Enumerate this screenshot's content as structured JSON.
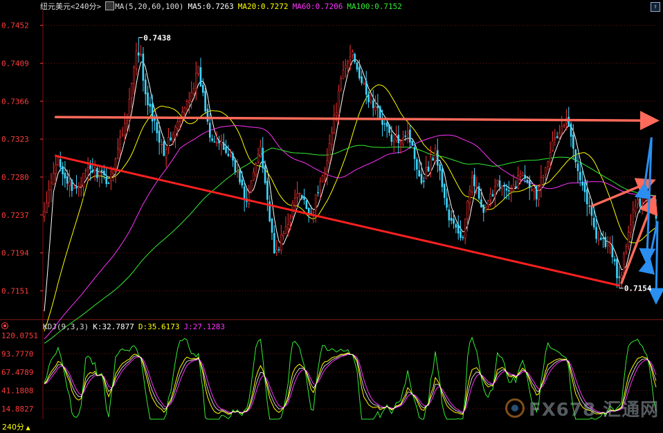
{
  "header": {
    "symbol": "纽元美元",
    "period": "<240分>",
    "ma_params": "MA(5,20,60,100)",
    "ma5": "MA5:0.7263",
    "ma20": "MA20:0.7272",
    "ma60": "MA60:0.7206",
    "ma100": "MA100:0.7152"
  },
  "kdj_header": {
    "params": "KDJ(9,3,3)",
    "k": "K:32.7877",
    "d": "D:35.6173",
    "j": "J:27.1283"
  },
  "period_tab": "240分",
  "watermark": "FX678 汇通网",
  "colors": {
    "up": "#ff3333",
    "down": "#3fd7ff",
    "ma5": "#ffffff",
    "ma20": "#ffff00",
    "ma60": "#ff33ff",
    "ma100": "#33ee33",
    "trend_red": "#ff2020",
    "trend_salmon": "#ff6a5a",
    "arrow_blue": "#2a8ff0",
    "grid": "#7a1010",
    "axis_text": "#ff3b3b"
  },
  "chart_data": [
    {
      "type": "candlestick",
      "title": "纽元美元<240分>",
      "y_ticks": [
        "0.7452",
        "0.7409",
        "0.7366",
        "0.7323",
        "0.7280",
        "0.7237",
        "0.7194",
        "0.7151"
      ],
      "ylim": [
        0.712,
        0.7465
      ],
      "annotations": [
        {
          "text": "0.7438",
          "index": 41,
          "price": 0.7438
        },
        {
          "text": "0.7154",
          "index": 250,
          "price": 0.7154
        }
      ],
      "anchors": [
        [
          0,
          0.724
        ],
        [
          6,
          0.7302
        ],
        [
          12,
          0.7262
        ],
        [
          20,
          0.729
        ],
        [
          28,
          0.7275
        ],
        [
          36,
          0.735
        ],
        [
          41,
          0.7438
        ],
        [
          44,
          0.737
        ],
        [
          52,
          0.731
        ],
        [
          60,
          0.735
        ],
        [
          67,
          0.74
        ],
        [
          72,
          0.733
        ],
        [
          82,
          0.73
        ],
        [
          88,
          0.725
        ],
        [
          94,
          0.7318
        ],
        [
          100,
          0.719
        ],
        [
          104,
          0.7215
        ],
        [
          110,
          0.7262
        ],
        [
          116,
          0.7238
        ],
        [
          122,
          0.729
        ],
        [
          130,
          0.74
        ],
        [
          134,
          0.7422
        ],
        [
          140,
          0.7372
        ],
        [
          146,
          0.735
        ],
        [
          152,
          0.7318
        ],
        [
          158,
          0.7332
        ],
        [
          164,
          0.7275
        ],
        [
          170,
          0.731
        ],
        [
          176,
          0.7232
        ],
        [
          182,
          0.721
        ],
        [
          186,
          0.7285
        ],
        [
          191,
          0.7235
        ],
        [
          197,
          0.7278
        ],
        [
          202,
          0.726
        ],
        [
          208,
          0.7287
        ],
        [
          214,
          0.726
        ],
        [
          220,
          0.7312
        ],
        [
          227,
          0.7345
        ],
        [
          233,
          0.7282
        ],
        [
          240,
          0.7215
        ],
        [
          246,
          0.72
        ],
        [
          250,
          0.716
        ],
        [
          256,
          0.7242
        ],
        [
          262,
          0.7262
        ],
        [
          266,
          0.7237
        ]
      ],
      "candle_count": 267,
      "series": [
        {
          "name": "MA5",
          "period": 5
        },
        {
          "name": "MA20",
          "period": 20
        },
        {
          "name": "MA60",
          "period": 60
        },
        {
          "name": "MA100",
          "period": 100
        }
      ],
      "overlays": [
        {
          "kind": "line",
          "color": "salmon",
          "from": [
            5,
            0.7348
          ],
          "to": [
            268,
            0.7344
          ],
          "arrow": true
        },
        {
          "kind": "line",
          "color": "red",
          "from": [
            5,
            0.7304
          ],
          "to": [
            250,
            0.7157
          ],
          "arrow": false
        },
        {
          "kind": "line",
          "color": "salmon",
          "from": [
            238,
            0.7247
          ],
          "to": [
            264,
            0.7275
          ],
          "arrow": true
        },
        {
          "kind": "line",
          "color": "salmon",
          "from": [
            251,
            0.716
          ],
          "to": [
            265,
            0.7255
          ],
          "arrow": true
        },
        {
          "kind": "zigzag",
          "color": "blue",
          "points": [
            [
              261,
              0.727
            ],
            [
              264,
              0.7325
            ],
            [
              262,
              0.7185
            ]
          ]
        },
        {
          "kind": "zigzag",
          "color": "blue",
          "points": [
            [
              263,
              0.7185
            ],
            [
              268,
              0.723
            ],
            [
              266,
              0.714
            ]
          ]
        }
      ]
    },
    {
      "type": "line",
      "title": "KDJ(9,3,3)",
      "y_ticks": [
        "120.0751",
        "93.7770",
        "67.4789",
        "41.1808",
        "14.8827"
      ],
      "ylim": [
        0,
        125
      ],
      "series": [
        {
          "name": "K",
          "color": "#ffffff"
        },
        {
          "name": "D",
          "color": "#ffff00"
        },
        {
          "name": "J",
          "color": "#ff33ff"
        }
      ],
      "extra_series_color": "#33ee33"
    }
  ]
}
